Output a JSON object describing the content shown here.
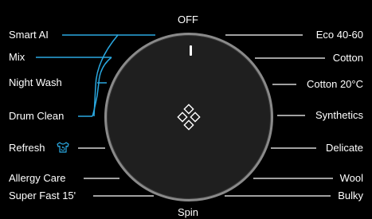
{
  "program_top": "OFF",
  "program_bottom": "Spin",
  "left_programs": [
    {
      "label": "Smart AI",
      "active": true
    },
    {
      "label": "Mix",
      "active": true
    },
    {
      "label": "Night Wash",
      "active": true
    },
    {
      "label": "Drum Clean",
      "active": true
    },
    {
      "label": "Refresh",
      "active": false
    },
    {
      "label": "Allergy Care",
      "active": false
    },
    {
      "label": "Super Fast 15'",
      "active": false
    }
  ],
  "right_programs": [
    {
      "label": "Eco 40-60"
    },
    {
      "label": "Cotton"
    },
    {
      "label": "Cotton 20°C"
    },
    {
      "label": "Synthetics"
    },
    {
      "label": "Delicate"
    },
    {
      "label": "Wool"
    },
    {
      "label": "Bulky"
    }
  ],
  "icons": {
    "dial_center": "diamond-cluster-icon",
    "refresh": "shirt-refresh-icon"
  },
  "colors": {
    "background": "#000000",
    "text": "#ffffff",
    "accent_line": "#2aa8e0",
    "neutral_line": "#ffffff",
    "dial_face": "#1f1f1f",
    "dial_ring": "#8a8a8a"
  }
}
